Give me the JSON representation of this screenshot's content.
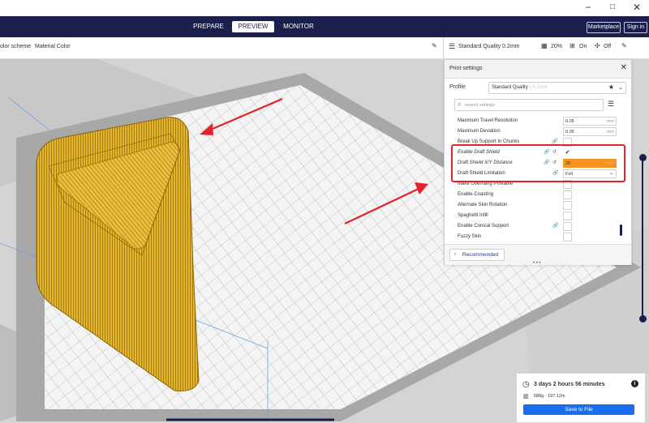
{
  "window": {
    "minimize": "−",
    "maximize": "□",
    "close": "✕"
  },
  "nav": {
    "tabs": [
      "PREPARE",
      "PREVIEW",
      "MONITOR"
    ],
    "active_tab": "PREVIEW",
    "marketplace": "Marketplace",
    "sign_in": "Sign in"
  },
  "viewbar": {
    "color_scheme_label": "olor scheme",
    "color_scheme_value": "Material Color",
    "edit_icon": "pencil-icon"
  },
  "print_setup": {
    "profile": "Standard Quality 0.2mm",
    "infill": "20%",
    "support": "On",
    "adhesion": "Off"
  },
  "print_settings": {
    "title": "Print settings",
    "close": "✕",
    "profile_label": "Profile",
    "profile_name": "Standard Quality",
    "profile_variant": "- 0.2mm",
    "search_placeholder": "search settings",
    "rows": [
      {
        "label": "Maximum Travel Resolution",
        "value": "0.05",
        "unit": "mm"
      },
      {
        "label": "Maximum Deviation",
        "value": "0.05",
        "unit": "mm"
      },
      {
        "label": "Break Up Support In Chunks"
      },
      {
        "label": "Enable Draft Shield",
        "checked": "✔"
      },
      {
        "label": "Draft Shield X/Y Distance",
        "value": "20",
        "unit": "mm"
      },
      {
        "label": "Draft Shield Limitation",
        "value": "Full"
      },
      {
        "label": "Make Overhang Printable"
      },
      {
        "label": "Enable Coasting"
      },
      {
        "label": "Alternate Skin Rotation"
      },
      {
        "label": "Spaghetti Infill"
      },
      {
        "label": "Enable Conical Support"
      },
      {
        "label": "Fuzzy Skin"
      }
    ],
    "recommended_label": "Recommended"
  },
  "output": {
    "print_time": "3 days 2 hours 56 minutes",
    "material": "588g · 197.12m",
    "save_label": "Save to File"
  },
  "colors": {
    "nav_bg": "#1b1f4b",
    "model_yellow": "#e3b62c",
    "highlight_red": "#e4222b",
    "field_orange": "#f7941d",
    "save_blue": "#196ef0"
  }
}
